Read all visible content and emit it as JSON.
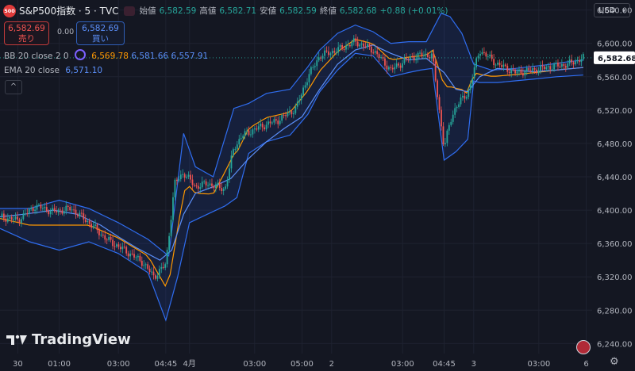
{
  "header": {
    "badge": "500",
    "symbol": "S&P500指数 · 5 · TVC",
    "open_label": "始値",
    "open": "6,582.59",
    "high_label": "高値",
    "high": "6,582.71",
    "low_label": "安値",
    "low": "6,582.59",
    "close_label": "終値",
    "close": "6,582.68",
    "change": "+0.88 (+0.01%)"
  },
  "trade": {
    "sell_price": "6,582.69",
    "sell_label": "売り",
    "spread": "0.00",
    "buy_price": "6,582.69",
    "buy_label": "買い"
  },
  "indicators": {
    "bb": {
      "name": "BB 20 close 2 0",
      "basis": "6,569.78",
      "upper": "6,581.66",
      "lower": "6,557.91"
    },
    "ema": {
      "name": "EMA 20 close",
      "value": "6,571.10"
    }
  },
  "ui": {
    "collapse": "^",
    "brand": "TradingView",
    "currency": "USD"
  },
  "colors": {
    "background": "#141722",
    "up": "#26a69a",
    "down": "#ef5350",
    "bb_band": "#2962ff",
    "bb_basis": "#ff9800",
    "ema": "#2962ff",
    "grid": "#1e2230",
    "price_tag": "#ffffff"
  },
  "chart_data": {
    "type": "line",
    "title": "",
    "ylim": [
      6228,
      6652
    ],
    "yticks": [
      "6,640.00",
      "6,600.00",
      "6,560.00",
      "6,520.00",
      "6,480.00",
      "6,440.00",
      "6,400.00",
      "6,360.00",
      "6,320.00",
      "6,280.00",
      "6,240.00"
    ],
    "xticks": [
      {
        "label": "30",
        "x": 0.3
      },
      {
        "label": "01:00",
        "x": 1.0
      },
      {
        "label": "03:00",
        "x": 2.0
      },
      {
        "label": "04:45",
        "x": 2.8
      },
      {
        "label": "4月",
        "x": 3.2
      },
      {
        "label": "03:00",
        "x": 4.3
      },
      {
        "label": "05:00",
        "x": 5.1
      },
      {
        "label": "2",
        "x": 5.6
      },
      {
        "label": "03:00",
        "x": 6.8
      },
      {
        "label": "04:45",
        "x": 7.5
      },
      {
        "label": "3",
        "x": 8.0
      },
      {
        "label": "03:00",
        "x": 9.1
      },
      {
        "label": "6",
        "x": 9.9
      }
    ],
    "last_price": "6,582.68",
    "last_value": 6582.68,
    "series": [
      {
        "name": "close",
        "x": [
          0,
          0.3,
          0.6,
          0.9,
          1.2,
          1.5,
          1.8,
          2.1,
          2.4,
          2.6,
          2.8,
          2.95,
          3.1,
          3.3,
          3.5,
          3.8,
          3.95,
          4.1,
          4.4,
          4.7,
          5.0,
          5.2,
          5.4,
          5.7,
          6.0,
          6.3,
          6.6,
          6.9,
          7.1,
          7.3,
          7.5,
          7.6,
          7.7,
          7.9,
          8.1,
          8.4,
          8.7,
          9.0,
          9.3,
          9.6,
          9.85
        ],
        "values": [
          6392,
          6388,
          6405,
          6398,
          6402,
          6385,
          6365,
          6352,
          6338,
          6320,
          6335,
          6432,
          6445,
          6428,
          6432,
          6425,
          6475,
          6490,
          6500,
          6508,
          6522,
          6560,
          6585,
          6592,
          6602,
          6592,
          6568,
          6582,
          6586,
          6586,
          6475,
          6505,
          6525,
          6540,
          6592,
          6575,
          6565,
          6568,
          6572,
          6575,
          6582.68
        ]
      },
      {
        "name": "BB upper",
        "x": [
          0,
          0.5,
          1.0,
          1.5,
          2.0,
          2.5,
          2.85,
          3.1,
          3.3,
          3.6,
          3.95,
          4.2,
          4.5,
          4.9,
          5.2,
          5.4,
          5.7,
          6.0,
          6.3,
          6.6,
          6.9,
          7.2,
          7.45,
          7.6,
          7.8,
          8.0,
          8.3,
          8.7,
          9.2,
          9.6,
          9.85
        ],
        "values": [
          6402,
          6402,
          6412,
          6402,
          6385,
          6365,
          6345,
          6492,
          6452,
          6440,
          6522,
          6528,
          6540,
          6545,
          6572,
          6592,
          6612,
          6622,
          6614,
          6600,
          6602,
          6602,
          6636,
          6632,
          6612,
          6575,
          6568,
          6570,
          6574,
          6578,
          6580
        ]
      },
      {
        "name": "BB lower",
        "x": [
          0,
          0.5,
          1.0,
          1.5,
          2.0,
          2.5,
          2.8,
          3.0,
          3.2,
          3.5,
          3.8,
          4.0,
          4.2,
          4.5,
          4.9,
          5.2,
          5.4,
          5.7,
          6.0,
          6.3,
          6.6,
          6.9,
          7.1,
          7.3,
          7.5,
          7.7,
          7.9,
          8.0,
          8.1,
          8.4,
          8.7,
          9.0,
          9.4,
          9.85
        ],
        "values": [
          6378,
          6362,
          6352,
          6362,
          6348,
          6325,
          6268,
          6320,
          6385,
          6395,
          6405,
          6415,
          6468,
          6482,
          6490,
          6515,
          6542,
          6568,
          6588,
          6585,
          6560,
          6565,
          6568,
          6570,
          6460,
          6470,
          6485,
          6555,
          6553,
          6553,
          6555,
          6557,
          6560,
          6562
        ]
      },
      {
        "name": "EMA",
        "x": [
          0,
          0.4,
          0.9,
          1.3,
          1.7,
          2.0,
          2.3,
          2.7,
          2.9,
          3.1,
          3.3,
          3.6,
          3.9,
          4.2,
          4.5,
          4.8,
          5.1,
          5.4,
          5.7,
          6.0,
          6.3,
          6.6,
          6.9,
          7.2,
          7.5,
          7.7,
          7.9,
          8.1,
          8.4,
          8.7,
          9.0,
          9.4,
          9.85
        ],
        "values": [
          6392,
          6395,
          6400,
          6395,
          6382,
          6368,
          6355,
          6340,
          6352,
          6395,
          6420,
          6428,
          6438,
          6462,
          6482,
          6498,
          6512,
          6545,
          6575,
          6592,
          6598,
          6588,
          6580,
          6582,
          6565,
          6545,
          6542,
          6560,
          6570,
          6568,
          6566,
          6568,
          6571
        ]
      }
    ]
  }
}
